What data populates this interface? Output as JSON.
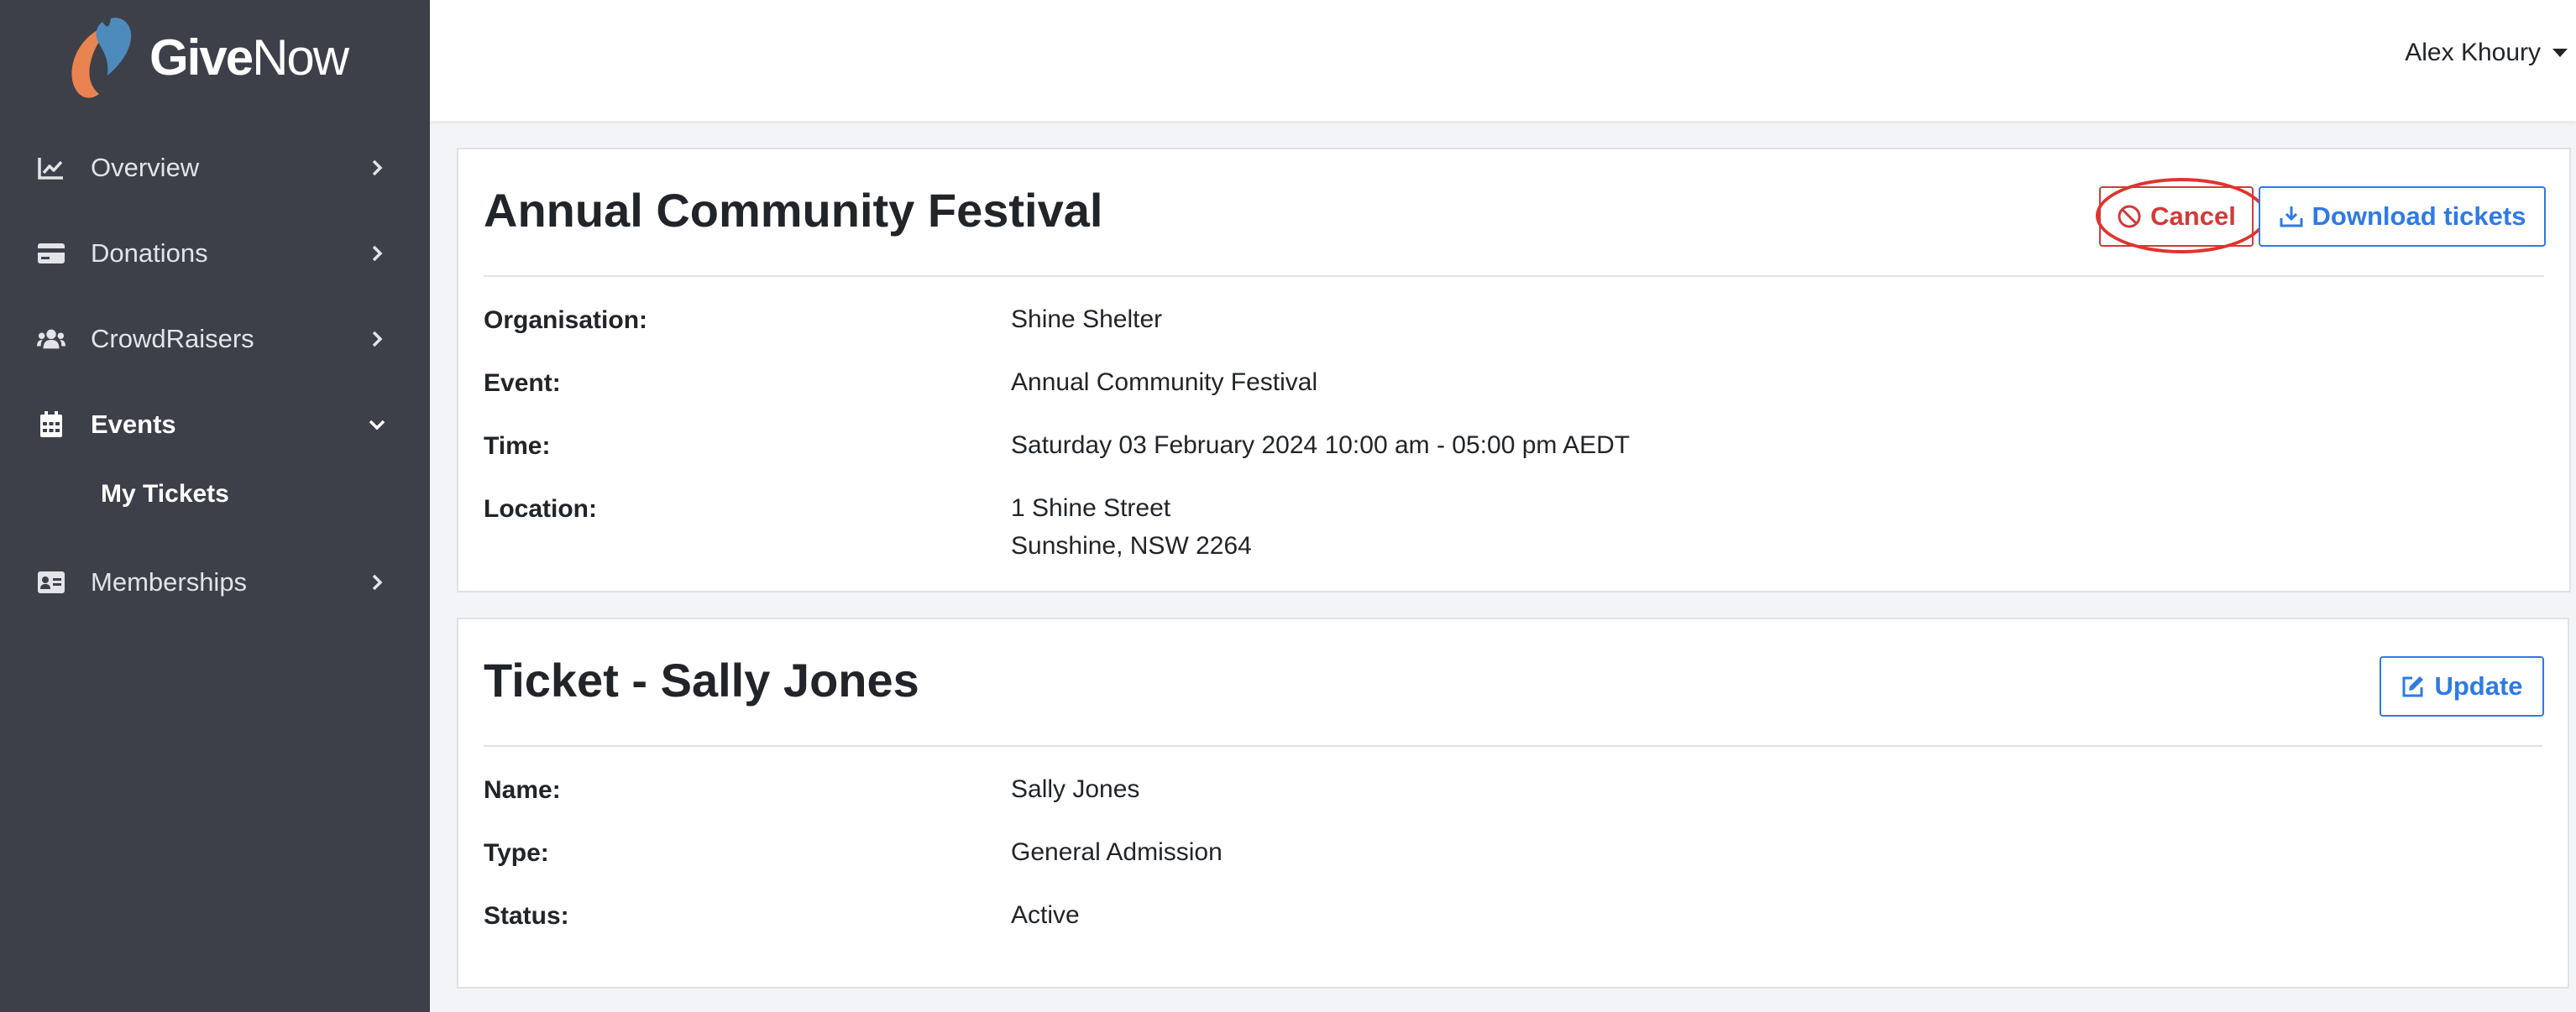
{
  "brand": {
    "name_bold": "Give",
    "name_light": "Now",
    "colors": {
      "heart_orange": "#e9834f",
      "heart_blue": "#4e8bbd"
    }
  },
  "sidebar": {
    "items": [
      {
        "label": "Overview",
        "icon": "chart-line-icon"
      },
      {
        "label": "Donations",
        "icon": "credit-card-icon"
      },
      {
        "label": "CrowdRaisers",
        "icon": "users-icon"
      },
      {
        "label": "Events",
        "icon": "calendar-icon",
        "expanded": true
      },
      {
        "label": "Memberships",
        "icon": "id-card-icon"
      }
    ],
    "sub_items": [
      {
        "label": "My Tickets"
      }
    ]
  },
  "header": {
    "user_name": "Alex Khoury"
  },
  "event_card": {
    "title": "Annual Community Festival",
    "cancel_label": "Cancel",
    "download_label": "Download tickets",
    "fields": [
      {
        "label": "Organisation:",
        "value": "Shine Shelter"
      },
      {
        "label": "Event:",
        "value": "Annual Community Festival"
      },
      {
        "label": "Time:",
        "value": "Saturday 03 February 2024 10:00 am - 05:00 pm AEDT"
      },
      {
        "label": "Location:",
        "value": "1 Shine Street",
        "value_line2": "Sunshine, NSW 2264"
      }
    ]
  },
  "ticket_card": {
    "title": "Ticket - Sally Jones",
    "update_label": "Update",
    "fields": [
      {
        "label": "Name:",
        "value": "Sally Jones"
      },
      {
        "label": "Type:",
        "value": "General Admission"
      },
      {
        "label": "Status:",
        "value": "Active"
      }
    ]
  },
  "colors": {
    "sidebar_bg": "#3d4049",
    "danger": "#d23a3a",
    "primary": "#2f7ae5",
    "annotation": "#e1332f"
  }
}
